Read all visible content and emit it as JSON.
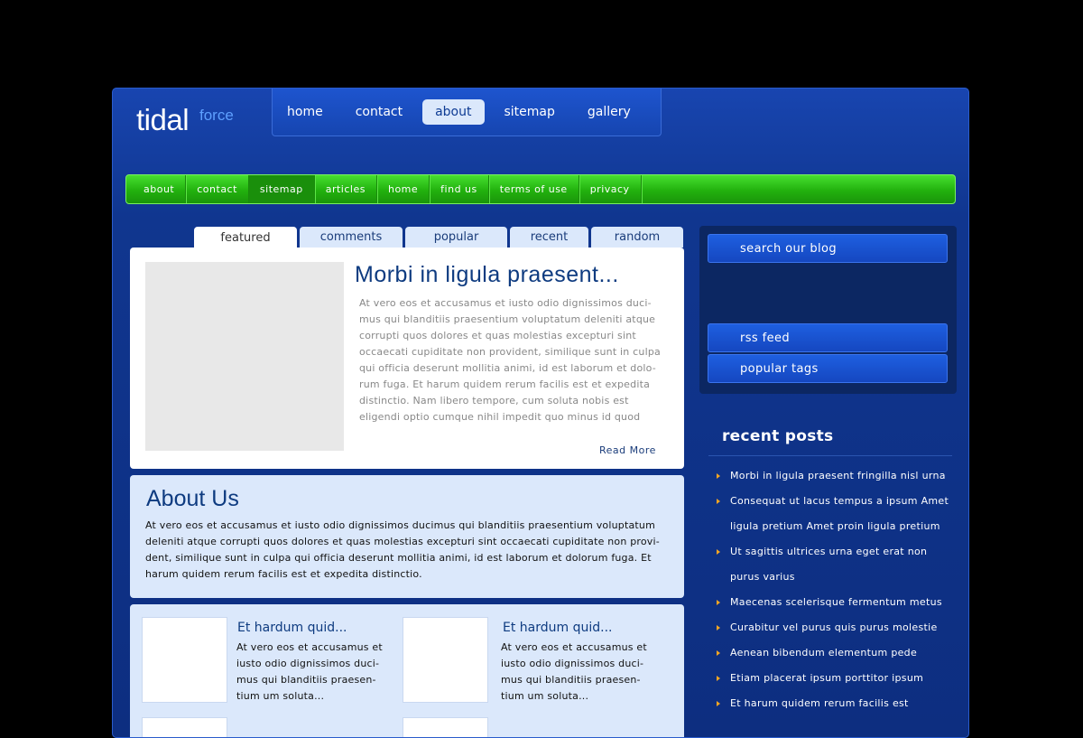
{
  "logo": {
    "main": "tidal",
    "sub": "force"
  },
  "topnav": [
    {
      "label": "home",
      "active": false
    },
    {
      "label": "contact",
      "active": false
    },
    {
      "label": "about",
      "active": true
    },
    {
      "label": "sitemap",
      "active": false
    },
    {
      "label": "gallery",
      "active": false
    }
  ],
  "subnav": [
    {
      "label": "about",
      "active": false
    },
    {
      "label": "contact",
      "active": false
    },
    {
      "label": "sitemap",
      "active": true
    },
    {
      "label": "articles",
      "active": false
    },
    {
      "label": "home",
      "active": false
    },
    {
      "label": "find us",
      "active": false
    },
    {
      "label": "terms of use",
      "active": false
    },
    {
      "label": "privacy",
      "active": false
    }
  ],
  "tabs": [
    {
      "label": "featured",
      "active": true
    },
    {
      "label": "comments",
      "active": false
    },
    {
      "label": "popular",
      "active": false
    },
    {
      "label": "recent",
      "active": false
    },
    {
      "label": "random",
      "active": false
    }
  ],
  "featured": {
    "title": "Morbi in ligula praesent...",
    "body": "At vero eos et accusamus et iusto odio dignissimos duci-mus qui blanditiis praesentium voluptatum deleniti atque corrupti quos dolores et quas molestias excepturi sint occaecati cupiditate non provident, similique sunt in culpa qui officia deserunt mollitia animi, id est laborum et dolo-rum fuga. Et harum quidem rerum facilis est et expedita distinctio. Nam libero tempore, cum soluta nobis est eligendi optio cumque nihil impedit quo minus id quod",
    "read_more": "Read More"
  },
  "about": {
    "title": "About Us",
    "body": "At vero eos et accusamus et iusto odio dignissimos ducimus qui blanditiis praesentium voluptatum deleniti atque corrupti quos dolores et quas molestias excepturi sint occaecati cupiditate non provi-dent, similique sunt in culpa qui officia deserunt mollitia animi, id est laborum et dolorum fuga. Et harum quidem rerum facilis est et expedita distinctio."
  },
  "cards": [
    {
      "title": "Et hardum quid...",
      "body": "At vero eos et accusamus et iusto odio dignissimos duci-mus qui blanditiis praesen-tium um soluta..."
    },
    {
      "title": "Et hardum quid...",
      "body": "At vero eos et accusamus et iusto odio dignissimos duci-mus qui blanditiis praesen-tium um soluta..."
    }
  ],
  "sidebar": {
    "search_label": "search our blog",
    "rss_label": "rss feed",
    "tags_label": "popular tags",
    "recent_title": "recent posts",
    "recent_posts": [
      "Morbi in ligula praesent fringilla nisl urna",
      "Consequat ut lacus tempus a ipsum Amet ligula pretium Amet proin ligula pretium",
      "Ut sagittis ultrices urna eget erat non purus varius",
      "Maecenas scelerisque fermentum metus",
      "Curabitur vel purus quis purus molestie",
      "Aenean bibendum elementum pede",
      "Etiam placerat ipsum porttitor ipsum",
      "Et harum quidem rerum facilis est"
    ]
  },
  "colors": {
    "page_bg": "#000000",
    "frame_blue": "#10368f",
    "green_nav": "#22b10e",
    "light_panel": "#dbe8fb",
    "bullet": "#f5a623"
  }
}
